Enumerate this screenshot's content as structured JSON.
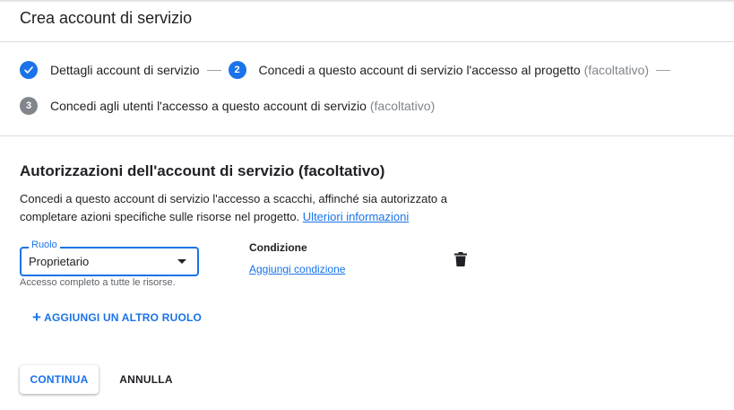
{
  "page": {
    "title": "Crea account di servizio"
  },
  "steps": [
    {
      "number": "",
      "label": "Dettagli account di servizio",
      "optional": "",
      "state": "done"
    },
    {
      "number": "2",
      "label": "Concedi a questo account di servizio l'accesso al progetto",
      "optional": "(facoltativo)",
      "state": "active"
    },
    {
      "number": "3",
      "label": "Concedi agli utenti l'accesso a questo account di servizio",
      "optional": "(facoltativo)",
      "state": "inactive"
    }
  ],
  "section": {
    "title": "Autorizzazioni dell'account di servizio (facoltativo)",
    "description": "Concedi a questo account di servizio l'accesso a scacchi, affinché sia autorizzato a completare azioni specifiche sulle risorse nel progetto.",
    "learn_more": "Ulteriori informazioni"
  },
  "role": {
    "label": "Ruolo",
    "value": "Proprietario",
    "helper": "Accesso completo a tutte le risorse."
  },
  "condition": {
    "label": "Condizione",
    "add_link": "Aggiungi condizione"
  },
  "icons": {
    "delete": "trash-icon",
    "step_done": "check-icon",
    "add": "plus-icon",
    "dropdown": "caret-down-icon"
  },
  "actions": {
    "add_role": "AGGIUNGI UN ALTRO RUOLO",
    "continue": "CONTINUA",
    "cancel": "ANNULLA"
  },
  "colors": {
    "accent": "#1a73e8",
    "inactive_step": "#80868b",
    "divider": "#dadce0"
  }
}
